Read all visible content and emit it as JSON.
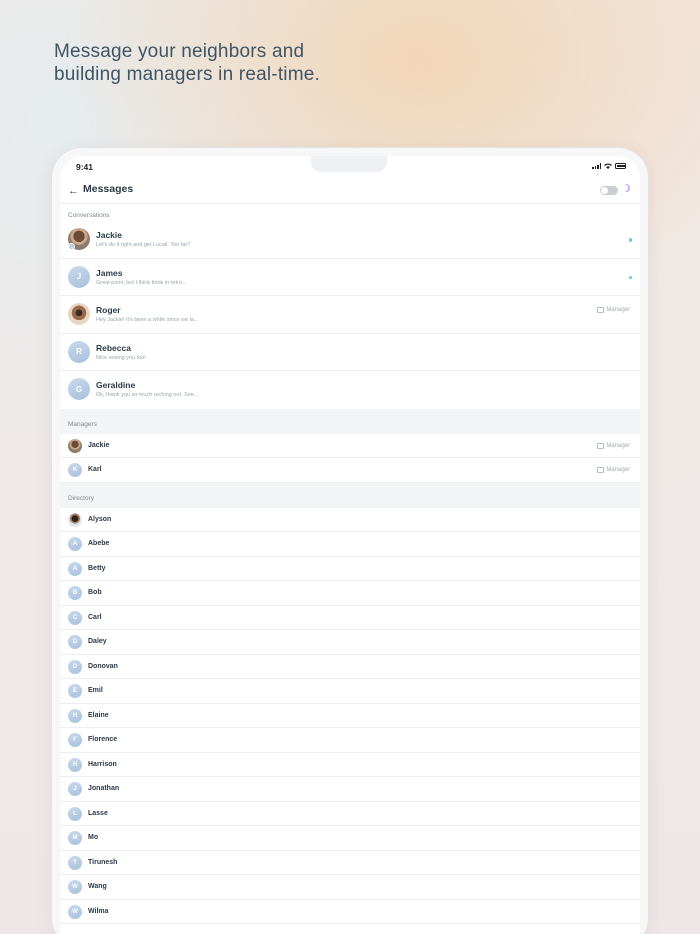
{
  "headline": "Message your neighbors and\nbuilding managers in real-time.",
  "status_bar": {
    "time": "9:41"
  },
  "app_bar": {
    "title": "Messages"
  },
  "sections": {
    "conversations": "Conversations",
    "managers": "Managers",
    "directory": "Directory"
  },
  "manager_label": "Manager",
  "conversations": [
    {
      "name": "Jackie",
      "preview": "Let's do it right and get Lucali. Too far?",
      "initial": "",
      "unread": true
    },
    {
      "name": "James",
      "preview": "Great point, but I think think in retro...",
      "initial": "J",
      "unread": true
    },
    {
      "name": "Roger",
      "preview": "Hey Jackie! It's been a while since we la...",
      "initial": "",
      "unread": false,
      "manager": true
    },
    {
      "name": "Rebecca",
      "preview": "Nice seeing you too!",
      "initial": "R",
      "unread": false
    },
    {
      "name": "Geraldine",
      "preview": "Ok, thank you so much reching out. See...",
      "initial": "G",
      "unread": false
    }
  ],
  "managers": [
    {
      "name": "Jackie",
      "initial": ""
    },
    {
      "name": "Karl",
      "initial": "K"
    }
  ],
  "directory": [
    {
      "name": "Alyson",
      "initial": ""
    },
    {
      "name": "Abebe",
      "initial": "A"
    },
    {
      "name": "Betty",
      "initial": "A"
    },
    {
      "name": "Bob",
      "initial": "B"
    },
    {
      "name": "Carl",
      "initial": "C"
    },
    {
      "name": "Daley",
      "initial": "D"
    },
    {
      "name": "Donovan",
      "initial": "D"
    },
    {
      "name": "Emil",
      "initial": "E"
    },
    {
      "name": "Elaine",
      "initial": "H"
    },
    {
      "name": "Florence",
      "initial": "F"
    },
    {
      "name": "Harrison",
      "initial": "H"
    },
    {
      "name": "Jonathan",
      "initial": "J"
    },
    {
      "name": "Lasse",
      "initial": "L"
    },
    {
      "name": "Mo",
      "initial": "M"
    },
    {
      "name": "Tirunesh",
      "initial": "T"
    },
    {
      "name": "Wang",
      "initial": "W"
    },
    {
      "name": "Wilma",
      "initial": "W"
    }
  ],
  "colors": {
    "accent": "#8a4fd8",
    "unread_dot": "#6ec9ef",
    "title_text": "#2b3a47"
  }
}
